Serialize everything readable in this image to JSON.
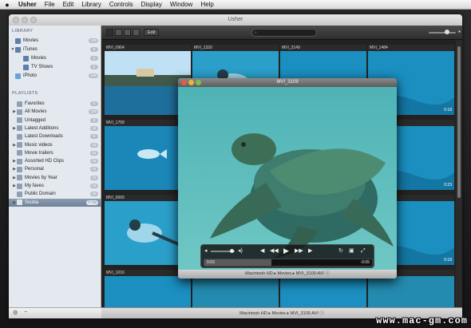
{
  "menubar": {
    "apple": "",
    "items": [
      "Usher",
      "File",
      "Edit",
      "Library",
      "Controls",
      "Display",
      "Window",
      "Help"
    ]
  },
  "window": {
    "title": "Usher"
  },
  "sidebar": {
    "library_header": "LIBRARY",
    "playlists_header": "PLAYLISTS",
    "library": [
      {
        "label": "Movies",
        "badge": "130",
        "icon": "film-icon"
      },
      {
        "label": "iTunes",
        "badge": "6",
        "icon": "itunes-icon"
      },
      {
        "label": "Movies",
        "badge": "4",
        "icon": "film-icon"
      },
      {
        "label": "TV Shows",
        "badge": "2",
        "icon": "tv-icon"
      },
      {
        "label": "iPhoto",
        "badge": "190",
        "icon": "iphoto-icon"
      }
    ],
    "playlists": [
      {
        "label": "Favorites",
        "badge": "3"
      },
      {
        "label": "All Movies",
        "badge": "130"
      },
      {
        "label": "Untagged",
        "badge": "8"
      },
      {
        "label": "Latest Additions",
        "badge": "16"
      },
      {
        "label": "Latest Downloads",
        "badge": "0"
      },
      {
        "label": "Music videos",
        "badge": "33"
      },
      {
        "label": "Movie trailers",
        "badge": "22"
      },
      {
        "label": "Assorted HD Clips",
        "badge": "18"
      },
      {
        "label": "Personal",
        "badge": "41"
      },
      {
        "label": "Movies by Year",
        "badge": "41"
      },
      {
        "label": "My faves",
        "badge": "18"
      },
      {
        "label": "Public Domain",
        "badge": "10"
      },
      {
        "label": "Scuba",
        "badge": "7 / 22",
        "selected": true
      }
    ],
    "add_button": "+",
    "settings_button": "⚙",
    "remove_button": "−"
  },
  "toolbar": {
    "edit_label": "Edit"
  },
  "thumbnails": [
    {
      "name": "MVI_0964",
      "duration": "",
      "scene": "shore"
    },
    {
      "name": "MVI_1320",
      "duration": "",
      "scene": "diver"
    },
    {
      "name": "MVI_3149",
      "duration": "",
      "scene": "water"
    },
    {
      "name": "MVI_1484",
      "duration": "0:18",
      "scene": "water"
    },
    {
      "name": "MVI_1758",
      "duration": "",
      "scene": "fish"
    },
    {
      "name": "",
      "duration": "",
      "scene": "water"
    },
    {
      "name": "",
      "duration": "",
      "scene": "water"
    },
    {
      "name": "",
      "duration": "0:23",
      "scene": "water"
    },
    {
      "name": "MVI_0069",
      "duration": "0:18",
      "scene": "diver"
    },
    {
      "name": "",
      "duration": "",
      "scene": "reef"
    },
    {
      "name": "",
      "duration": "",
      "scene": "reef"
    },
    {
      "name": "",
      "duration": "0:18",
      "scene": "water"
    },
    {
      "name": "MVI_1016",
      "duration": "",
      "scene": "water"
    },
    {
      "name": "",
      "duration": "",
      "scene": "reef"
    },
    {
      "name": "",
      "duration": "",
      "scene": "water"
    },
    {
      "name": "",
      "duration": "",
      "scene": "reef"
    }
  ],
  "status_bar": {
    "path": "Macintosh HD ▸ Movies ▸ MVI_3109.AVI ⓘ"
  },
  "player": {
    "title": "MVI_3109",
    "elapsed": "0:03",
    "remaining": "-0:05",
    "progress": 0.4,
    "path": "Macintosh HD ▸ Movies ▸ MVI_3109.AVI ⓘ",
    "controls": [
      "volume-low-icon",
      "volume-high-icon",
      "step-back-icon",
      "rewind-icon",
      "play-icon",
      "fast-forward-icon",
      "step-forward-icon",
      "loop-icon",
      "aspect-icon",
      "fullscreen-icon"
    ]
  },
  "watermark": "www.mac-gm.com",
  "colors": {
    "sidebar_bg": "#e4e9ef",
    "selection": "#7b8ba0",
    "water": "#1e9cc8"
  }
}
